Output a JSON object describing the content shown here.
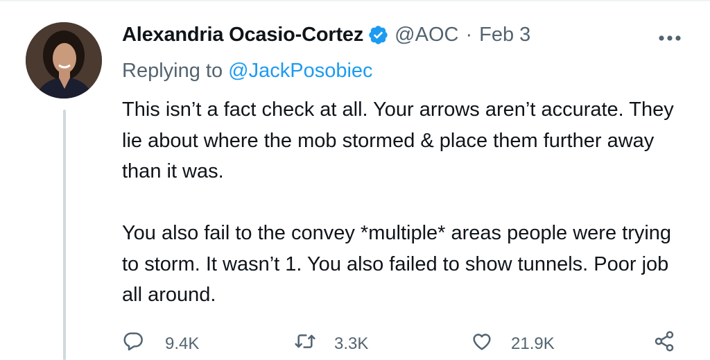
{
  "tweet": {
    "author_name": "Alexandria Ocasio-Cortez",
    "verified": true,
    "handle": "@AOC",
    "separator": "·",
    "date": "Feb 3",
    "replying_label": "Replying to",
    "replying_handle": "@JackPosobiec",
    "body_paragraphs": [
      "This isn’t a fact check at all. Your arrows aren’t accurate. They lie about where the mob stormed & place them further away than it was.",
      "You also fail to the convey *multiple* areas people were trying to storm. It wasn’t 1. You also failed to show tunnels. Poor job all around."
    ],
    "stats": {
      "replies": "9.4K",
      "retweets": "3.3K",
      "likes": "21.9K"
    }
  },
  "icons": {
    "more": "more-horizontal-icon",
    "verified": "verified-badge-icon",
    "reply": "reply-bubble-icon",
    "retweet": "retweet-icon",
    "like": "heart-icon",
    "share": "share-icon"
  },
  "colors": {
    "text": "#0f1419",
    "secondary": "#536471",
    "accent": "#1d9bf0",
    "thread_line": "#cfd9de"
  }
}
